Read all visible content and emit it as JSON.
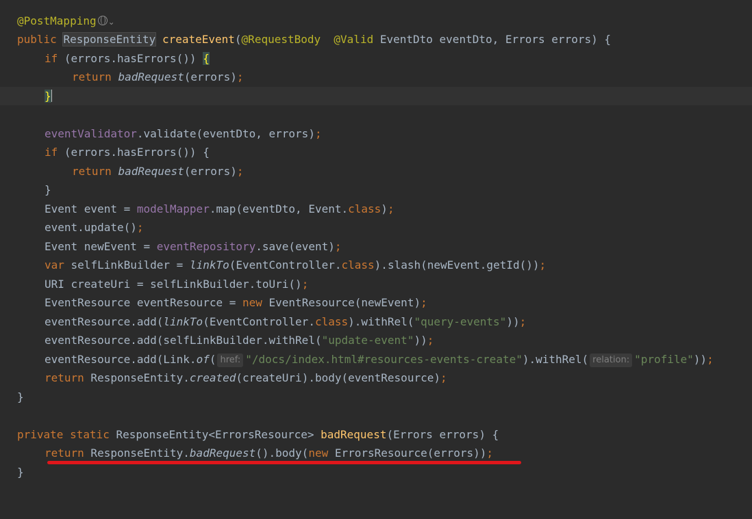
{
  "editor": {
    "annotation_line": "@PostMapping",
    "signature": {
      "modifier": "public",
      "return_type": "ResponseEntity",
      "method": "createEvent",
      "params_open": "(",
      "request_body": "@RequestBody",
      "valid": "@Valid",
      "params_rest": "EventDto eventDto, Errors errors) {"
    },
    "lines": {
      "l3_if": "if",
      "l3_rest": " (errors.hasErrors()) ",
      "l3_brace": "{",
      "l4_return": "return",
      "l4_call": "badRequest",
      "l4_rest": "(errors)",
      "l4_semi": ";",
      "l5_brace": "}",
      "l7_field": "eventValidator",
      "l7_rest": ".validate(eventDto, errors)",
      "l7_semi": ";",
      "l8_if": "if",
      "l8_rest": " (errors.hasErrors()) {",
      "l9_return": "return",
      "l9_call": "badRequest",
      "l9_rest": "(errors)",
      "l9_semi": ";",
      "l10_brace": "}",
      "l11_a": "Event event = ",
      "l11_field": "modelMapper",
      "l11_b": ".map(eventDto, Event.",
      "l11_class": "class",
      "l11_c": ")",
      "l11_semi": ";",
      "l12_a": "event.update()",
      "l12_semi": ";",
      "l13_a": "Event newEvent = ",
      "l13_field": "eventRepository",
      "l13_b": ".save(event)",
      "l13_semi": ";",
      "l14_var": "var",
      "l14_a": " selfLinkBuilder = ",
      "l14_call": "linkTo",
      "l14_b": "(EventController.",
      "l14_class": "class",
      "l14_c": ").slash(newEvent.getId())",
      "l14_semi": ";",
      "l15_a": "URI createUri = selfLinkBuilder.toUri()",
      "l15_semi": ";",
      "l16_a": "EventResource eventResource = ",
      "l16_new": "new",
      "l16_b": " EventResource(newEvent)",
      "l16_semi": ";",
      "l17_a": "eventResource.add(",
      "l17_call": "linkTo",
      "l17_b": "(EventController.",
      "l17_class": "class",
      "l17_c": ").withRel(",
      "l17_str": "\"query-events\"",
      "l17_d": "))",
      "l17_semi": ";",
      "l18_a": "eventResource.add(selfLinkBuilder.withRel(",
      "l18_str": "\"update-event\"",
      "l18_b": "))",
      "l18_semi": ";",
      "l19_a": "eventResource.add(Link.",
      "l19_call": "of",
      "l19_b": "(",
      "l19_hint1": "href:",
      "l19_str1": "\"/docs/index.html#resources-events-create\"",
      "l19_c": ").withRel(",
      "l19_hint2": "relation:",
      "l19_str2": "\"profile\"",
      "l19_d": "))",
      "l19_semi": ";",
      "l20_return": "return",
      "l20_a": " ResponseEntity.",
      "l20_call": "created",
      "l20_b": "(createUri).body(eventResource)",
      "l20_semi": ";",
      "l21_brace": "}",
      "l23_private": "private",
      "l23_static": "static",
      "l23_a": " ResponseEntity<ErrorsResource> ",
      "l23_method": "badRequest",
      "l23_b": "(Errors errors) {",
      "l24_return": "return",
      "l24_a": " ResponseEntity.",
      "l24_call": "badRequest",
      "l24_b": "().body(",
      "l24_new": "new",
      "l24_c": " ErrorsResource(errors))",
      "l24_semi": ";",
      "l25_brace": "}"
    }
  },
  "colors": {
    "background": "#2b2b2b",
    "keyword": "#cc7832",
    "annotation": "#bbb529",
    "method_decl": "#ffc66d",
    "field": "#9876aa",
    "string": "#6a8759",
    "plain": "#a9b7c6",
    "underline_mark": "#e0161b"
  },
  "icons": {
    "endpoint_globe": "globe-icon",
    "endpoint_dropdown": "chevron-down-icon"
  }
}
